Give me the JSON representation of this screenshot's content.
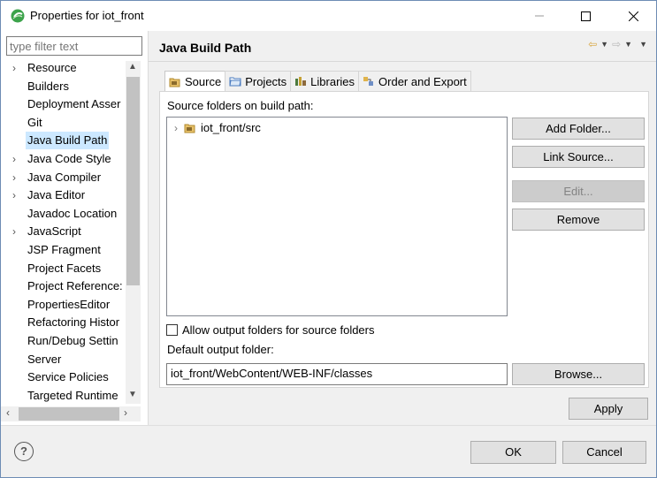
{
  "window": {
    "title": "Properties for iot_front"
  },
  "filter": {
    "placeholder": "type filter text"
  },
  "tree": {
    "items": [
      {
        "label": "Resource",
        "expandable": true
      },
      {
        "label": "Builders",
        "expandable": false
      },
      {
        "label": "Deployment Asser",
        "expandable": false
      },
      {
        "label": "Git",
        "expandable": false
      },
      {
        "label": "Java Build Path",
        "expandable": false,
        "selected": true
      },
      {
        "label": "Java Code Style",
        "expandable": true
      },
      {
        "label": "Java Compiler",
        "expandable": true
      },
      {
        "label": "Java Editor",
        "expandable": true
      },
      {
        "label": "Javadoc Location",
        "expandable": false
      },
      {
        "label": "JavaScript",
        "expandable": true
      },
      {
        "label": "JSP Fragment",
        "expandable": false
      },
      {
        "label": "Project Facets",
        "expandable": false
      },
      {
        "label": "Project Reference:",
        "expandable": false
      },
      {
        "label": "PropertiesEditor",
        "expandable": false
      },
      {
        "label": "Refactoring Histor",
        "expandable": false
      },
      {
        "label": "Run/Debug Settin",
        "expandable": false
      },
      {
        "label": "Server",
        "expandable": false
      },
      {
        "label": "Service Policies",
        "expandable": false
      },
      {
        "label": "Targeted Runtime",
        "expandable": false
      }
    ]
  },
  "page": {
    "title": "Java Build Path",
    "tabs": [
      {
        "label": "Source",
        "active": true
      },
      {
        "label": "Projects",
        "active": false
      },
      {
        "label": "Libraries",
        "active": false
      },
      {
        "label": "Order and Export",
        "active": false
      }
    ],
    "source_label": "Source folders on build path:",
    "source_folders": [
      {
        "label": "iot_front/src"
      }
    ],
    "buttons": {
      "add_folder": "Add Folder...",
      "link_source": "Link Source...",
      "edit": "Edit...",
      "remove": "Remove",
      "browse": "Browse...",
      "apply": "Apply"
    },
    "allow_output_label": "Allow output folders for source folders",
    "allow_output_checked": false,
    "default_output_label": "Default output folder:",
    "default_output_value": "iot_front/WebContent/WEB-INF/classes"
  },
  "footer": {
    "ok": "OK",
    "cancel": "Cancel"
  },
  "colors": {
    "selection": "#cce8ff",
    "accent": "#d8a43c"
  }
}
